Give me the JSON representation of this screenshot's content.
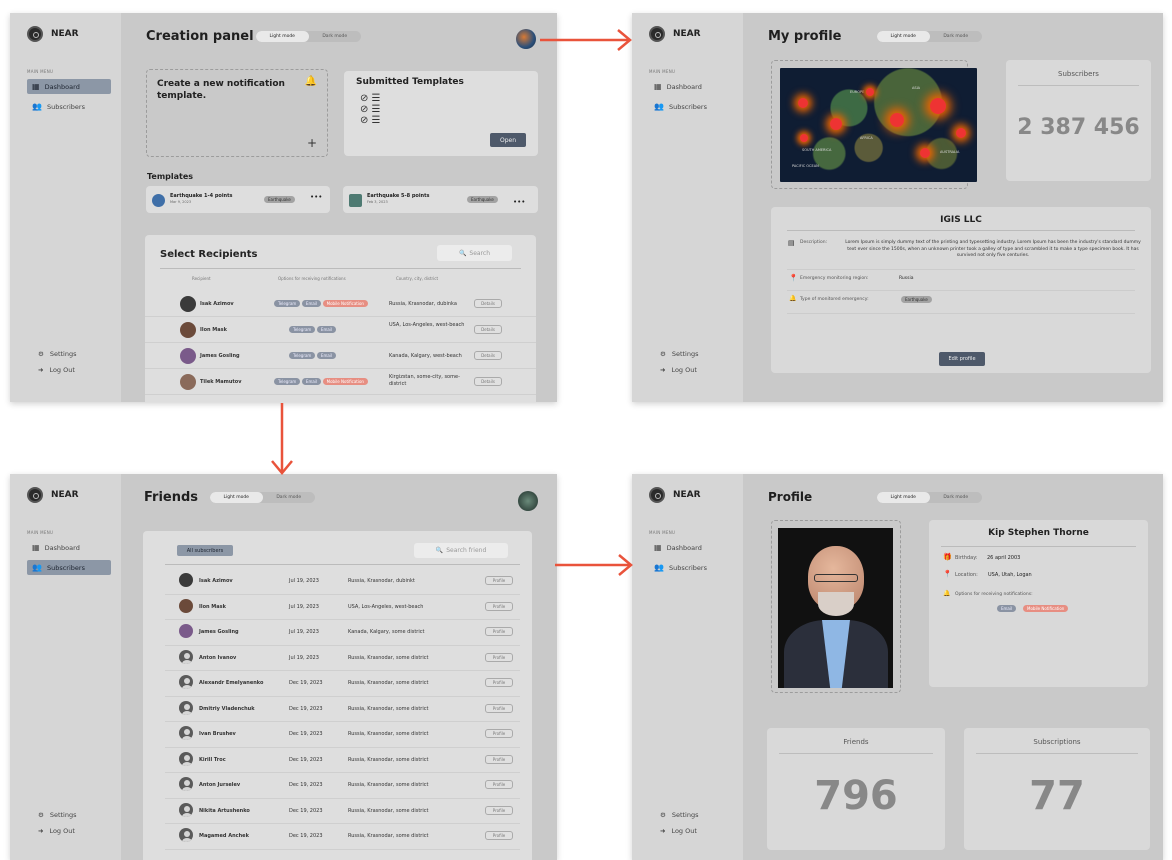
{
  "brand": "NEAR",
  "menu_header": "MAIN MENU",
  "nav": {
    "dashboard": "Dashboard",
    "subscribers": "Subscribers",
    "settings": "Settings",
    "logout": "Log Out"
  },
  "mode": {
    "light": "Light mode",
    "dark": "Dark mode"
  },
  "accent": "#e9533b",
  "s1": {
    "title": "Creation panel",
    "new_template": "Create a new notification template.",
    "submitted": "Submitted Templates",
    "open_btn": "Open",
    "templates_hdr": "Templates",
    "templates": [
      {
        "name": "Earthquake 1-4 points",
        "date": "Mar 9, 2023",
        "tag": "Earthquake"
      },
      {
        "name": "Earthquake 5-8 points",
        "date": "Feb 3, 2023",
        "tag": "Earthquake"
      }
    ],
    "select_title": "Select Recipients",
    "search": "Search",
    "cols": [
      "Recipient",
      "Options for receiving notifications",
      "Country, city, district"
    ],
    "details": "Details",
    "rows": [
      {
        "name": "Isak Azimov",
        "opts": [
          "Telegram",
          "Email",
          "Mobile Notification"
        ],
        "loc": "Russia, Krasnodar, dubinka"
      },
      {
        "name": "Ilon Mask",
        "opts": [
          "Telegram",
          "Email"
        ],
        "loc": "USA, Los-Angeles, west-beach"
      },
      {
        "name": "James Gosling",
        "opts": [
          "Telegram",
          "Email"
        ],
        "loc": "Kanada, Kalgary, west-beach"
      },
      {
        "name": "Tilek Mamutov",
        "opts": [
          "Telegram",
          "Email",
          "Mobile Notification"
        ],
        "loc": "Kirgizstan, some-city, some-district"
      }
    ]
  },
  "s2": {
    "title": "My profile",
    "map_labels": [
      "EUROPE",
      "ASIA",
      "AFRICA",
      "PACIFIC OCEAN",
      "SOUTH AMERICA",
      "AUSTRALIA"
    ],
    "subs_label": "Subscribers",
    "subs_value": "2 387 456",
    "company": "IGIS LLC",
    "desc_label": "Description:",
    "desc": "Lorem Ipsum is simply dummy text of the printing and typesetting industry. Lorem Ipsum has been the industry's standard dummy text ever since the 1500s, when an unknown printer took a galley of type and scrambled it to make a type specimen book. It has survived not only five centuries.",
    "region_label": "Emergency monitoring region:",
    "region": "Russia",
    "type_label": "Type of monitored emergency:",
    "type": "Earthquake",
    "edit_btn": "Edit profile"
  },
  "s3": {
    "title": "Friends",
    "all_btn": "All subscribers",
    "search": "Search friend",
    "profile_btn": "Profile",
    "rows": [
      {
        "name": "Isak Azimov",
        "date": "Jul 19, 2023",
        "loc": "Russia, Krasnodar, dubinkt"
      },
      {
        "name": "Ilon Mask",
        "date": "Jul 19, 2023",
        "loc": "USA, Los-Angeles, west-beach"
      },
      {
        "name": "James Gosling",
        "date": "Jul 19, 2023",
        "loc": "Kanada, Kalgary, some district"
      },
      {
        "name": "Anton Ivanov",
        "date": "Jul 19, 2023",
        "loc": "Russia, Krasnodar, some district"
      },
      {
        "name": "Alexandr Emelyanenko",
        "date": "Dec 19, 2023",
        "loc": "Russia, Krasnodar, some district"
      },
      {
        "name": "Dmitriy Vladenchuk",
        "date": "Dec 19, 2023",
        "loc": "Russia, Krasnodar, some district"
      },
      {
        "name": "Ivan Brushev",
        "date": "Dec 19, 2023",
        "loc": "Russia, Krasnodar, some district"
      },
      {
        "name": "Kirill Troc",
        "date": "Dec 19, 2023",
        "loc": "Russia, Krasnodar, some district"
      },
      {
        "name": "Anton Jurselev",
        "date": "Dec 19, 2023",
        "loc": "Russia, Krasnodar, some district"
      },
      {
        "name": "Nikita Artushenko",
        "date": "Dec 19, 2023",
        "loc": "Russia, Krasnodar, some district"
      },
      {
        "name": "Magamed Anchek",
        "date": "Dec 19, 2023",
        "loc": "Russia, Krasnodar, some district"
      }
    ]
  },
  "s4": {
    "title": "Profile",
    "name": "Kip Stephen Thorne",
    "birthday_label": "Birthday:",
    "birthday": "26 april 2003",
    "location_label": "Location:",
    "location": "USA, Utah, Logan",
    "options_label": "Options for receiving notifications:",
    "options": [
      "Email",
      "Mobile Notification"
    ],
    "friends_label": "Friends",
    "friends": "796",
    "subs_label": "Subscriptions",
    "subs": "77"
  }
}
